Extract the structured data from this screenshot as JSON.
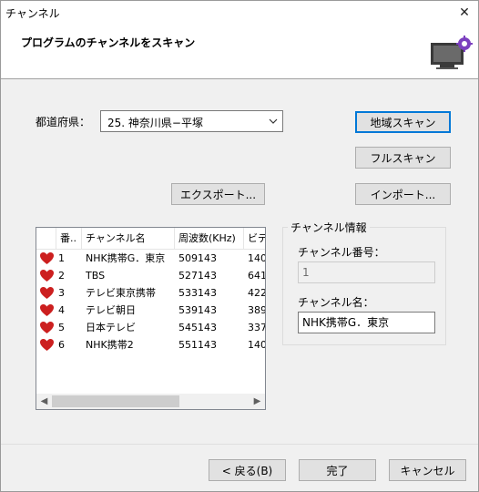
{
  "window": {
    "title": "チャンネル",
    "close_glyph": "✕"
  },
  "header": {
    "heading": "プログラムのチャンネルをスキャン",
    "icon": "tv-settings-icon"
  },
  "prefecture": {
    "label": "都道府県：",
    "value": "25. 神奈川県−平塚"
  },
  "buttons": {
    "area_scan": "地域スキャン",
    "full_scan": "フルスキャン",
    "export": "エクスポート...",
    "import": "インポート...",
    "back": "< 戻る(B)",
    "finish": "完了",
    "cancel": "キャンセル"
  },
  "channel_list": {
    "columns": [
      "番..",
      "チャンネル名",
      "周波数(KHz)",
      "ビデ"
    ],
    "rows": [
      {
        "no": "1",
        "name": "NHK携帯G．東京",
        "freq": "509143",
        "video": "140"
      },
      {
        "no": "2",
        "name": "TBS",
        "freq": "527143",
        "video": "641"
      },
      {
        "no": "3",
        "name": "テレビ東京携帯",
        "freq": "533143",
        "video": "422"
      },
      {
        "no": "4",
        "name": "テレビ朝日",
        "freq": "539143",
        "video": "389"
      },
      {
        "no": "5",
        "name": "日本テレビ",
        "freq": "545143",
        "video": "337"
      },
      {
        "no": "6",
        "name": "NHK携帯2",
        "freq": "551143",
        "video": "140"
      }
    ],
    "favorite_icon": "heart-icon",
    "favorite_color": "#cc1f1f"
  },
  "channel_info": {
    "group_title": "チャンネル情報",
    "number_label": "チャンネル番号：",
    "number_value": "1",
    "name_label": "チャンネル名：",
    "name_value": "NHK携帯G．東京"
  },
  "colors": {
    "accent": "#0078d7"
  }
}
